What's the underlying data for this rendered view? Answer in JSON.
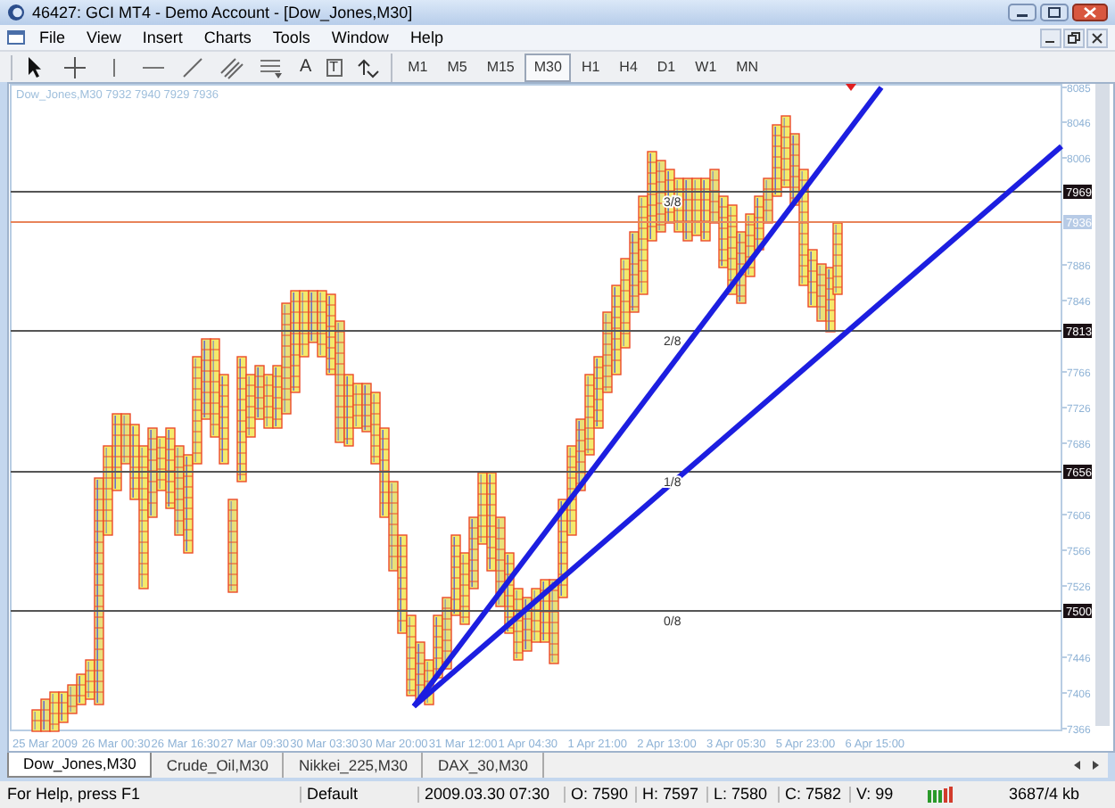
{
  "window": {
    "title": "46427: GCI MT4 - Demo Account - [Dow_Jones,M30]"
  },
  "menu": [
    "File",
    "View",
    "Insert",
    "Charts",
    "Tools",
    "Window",
    "Help"
  ],
  "toolbar": {
    "tools": [
      {
        "kind": "cursor"
      },
      {
        "kind": "crosshair"
      },
      {
        "kind": "vline"
      },
      {
        "kind": "hline"
      },
      {
        "kind": "trendline"
      },
      {
        "kind": "channel"
      },
      {
        "kind": "fibo"
      },
      {
        "kind": "text",
        "label": "A"
      },
      {
        "kind": "label",
        "label": "T"
      },
      {
        "kind": "arrows"
      }
    ],
    "timeframes": [
      {
        "label": "M1",
        "selected": false
      },
      {
        "label": "M5",
        "selected": false
      },
      {
        "label": "M15",
        "selected": false
      },
      {
        "label": "M30",
        "selected": true
      },
      {
        "label": "H1",
        "selected": false
      },
      {
        "label": "H4",
        "selected": false
      },
      {
        "label": "D1",
        "selected": false
      },
      {
        "label": "W1",
        "selected": false
      },
      {
        "label": "MN",
        "selected": false
      }
    ]
  },
  "chart": {
    "header": "Dow_Jones,M30  7932 7940 7929 7936",
    "price_axis": [
      "8085",
      "8046",
      "8006",
      "7886",
      "7846",
      "7766",
      "7726",
      "7686",
      "7606",
      "7566",
      "7526",
      "7446",
      "7406",
      "7366"
    ],
    "levels": [
      {
        "price": "7969",
        "fraction": "3/8"
      },
      {
        "price": "7813",
        "fraction": "2/8"
      },
      {
        "price": "7656",
        "fraction": "1/8"
      },
      {
        "price": "7500",
        "fraction": "0/8"
      }
    ],
    "bid": {
      "price": "7936"
    },
    "time_axis": [
      "25 Mar 2009",
      "26 Mar 00:30",
      "26 Mar 16:30",
      "27 Mar 09:30",
      "30 Mar 03:30",
      "30 Mar 20:00",
      "31 Mar 12:00",
      "1 Apr 04:30",
      "1 Apr 21:00",
      "2 Apr 13:00",
      "3 Apr 05:30",
      "5 Apr 23:00",
      "6 Apr 15:00"
    ]
  },
  "tabs": [
    {
      "label": "Dow_Jones,M30",
      "selected": true
    },
    {
      "label": "Crude_Oil,M30",
      "selected": false
    },
    {
      "label": "Nikkei_225,M30",
      "selected": false
    },
    {
      "label": "DAX_30,M30",
      "selected": false
    }
  ],
  "status_bar": {
    "help": "For Help, press F1",
    "profile": "Default",
    "time": "2009.03.30 07:30",
    "open": "O: 7590",
    "high": "H: 7597",
    "low": "L: 7580",
    "close": "C: 7582",
    "volume": "V: 99",
    "traffic": "3687/4 kb"
  }
}
